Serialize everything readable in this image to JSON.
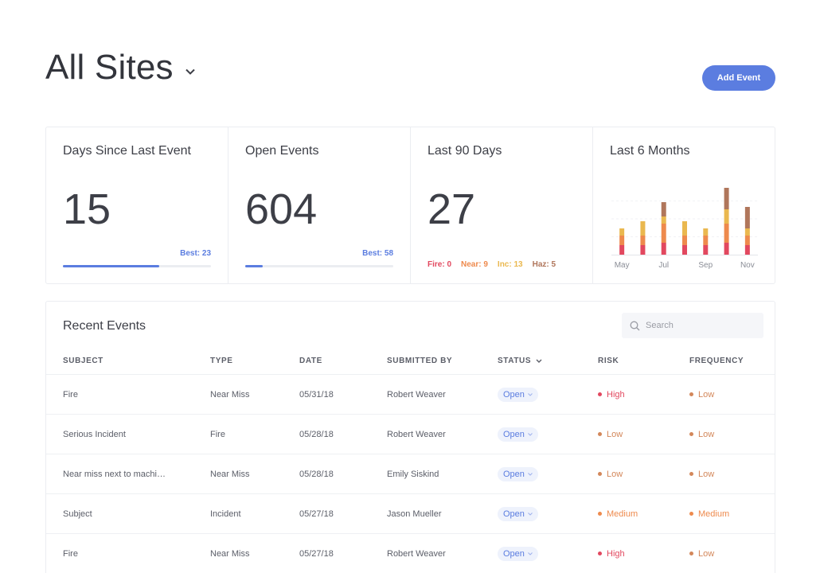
{
  "header": {
    "title": "All Sites",
    "add_button": "Add Event"
  },
  "stats": {
    "days_since": {
      "label": "Days Since Last Event",
      "value": "15",
      "best": "Best: 23",
      "progress": 0.65
    },
    "open_events": {
      "label": "Open Events",
      "value": "604",
      "best": "Best: 58",
      "progress": 0.12
    },
    "last_90": {
      "label": "Last 90 Days",
      "value": "27",
      "breakdown": [
        {
          "text": "Fire: 0",
          "color": "#e2485f"
        },
        {
          "text": "Near: 9",
          "color": "#ee8a4d"
        },
        {
          "text": "Inc: 13",
          "color": "#eab84f"
        },
        {
          "text": "Haz: 5",
          "color": "#b0765b"
        }
      ]
    },
    "last_6": {
      "label": "Last 6 Months"
    }
  },
  "chart_data": {
    "type": "bar",
    "stacked": true,
    "categories": [
      "May",
      "Jun",
      "Jul",
      "Aug",
      "Sep",
      "Oct",
      "Nov"
    ],
    "tick_labels": [
      "May",
      "Jul",
      "Sep",
      "Nov"
    ],
    "series": [
      {
        "values": [
          4,
          4,
          5,
          4,
          4,
          5,
          4
        ],
        "color": "#e2485f"
      },
      {
        "values": [
          4,
          4,
          8,
          4,
          4,
          8,
          4
        ],
        "color": "#ee8a4d"
      },
      {
        "values": [
          3,
          6,
          3,
          6,
          3,
          6,
          3
        ],
        "color": "#eab84f"
      },
      {
        "values": [
          0,
          0,
          6,
          0,
          0,
          9,
          9
        ],
        "color": "#b0765b"
      }
    ],
    "ylim": [
      0,
      30
    ],
    "grid": true
  },
  "events": {
    "title": "Recent Events",
    "search_placeholder": "Search",
    "columns": [
      "SUBJECT",
      "TYPE",
      "DATE",
      "SUBMITTED BY",
      "STATUS",
      "RISK",
      "FREQUENCY"
    ],
    "level_colors": {
      "High": "#e2485f",
      "Medium": "#ee8a4d",
      "Low": "#d3875a"
    },
    "rows": [
      {
        "subject": "Fire",
        "type": "Near Miss",
        "date": "05/31/18",
        "by": "Robert Weaver",
        "status": "Open",
        "risk": "High",
        "frequency": "Low"
      },
      {
        "subject": "Serious Incident",
        "type": "Fire",
        "date": "05/28/18",
        "by": "Robert Weaver",
        "status": "Open",
        "risk": "Low",
        "frequency": "Low"
      },
      {
        "subject": "Near miss next to machi…",
        "type": "Near Miss",
        "date": "05/28/18",
        "by": "Emily Siskind",
        "status": "Open",
        "risk": "Low",
        "frequency": "Low"
      },
      {
        "subject": "Subject",
        "type": "Incident",
        "date": "05/27/18",
        "by": "Jason Mueller",
        "status": "Open",
        "risk": "Medium",
        "frequency": "Medium"
      },
      {
        "subject": "Fire",
        "type": "Near Miss",
        "date": "05/27/18",
        "by": "Robert Weaver",
        "status": "Open",
        "risk": "High",
        "frequency": "Low"
      }
    ]
  }
}
